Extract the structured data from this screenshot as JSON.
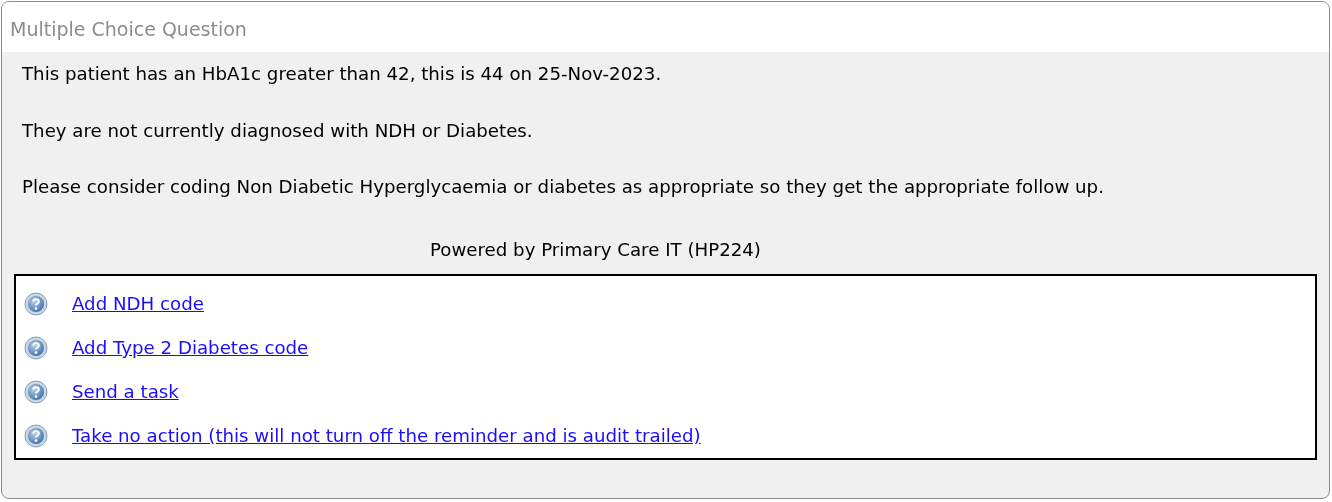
{
  "window": {
    "title": "Multiple Choice Question"
  },
  "message": [
    "This patient has an HbA1c greater than 42, this is 44 on 25-Nov-2023.",
    "They are not currently diagnosed with NDH or Diabetes.",
    "Please consider coding Non Diabetic Hyperglycaemia or diabetes as appropriate so they get the appropriate follow up."
  ],
  "footer": "Powered by Primary Care IT (HP224)",
  "options": [
    {
      "label": "Add NDH code"
    },
    {
      "label": "Add Type 2 Diabetes code"
    },
    {
      "label": "Send a task"
    },
    {
      "label": "Take no action (this will not turn off the reminder and is audit trailed)"
    }
  ]
}
